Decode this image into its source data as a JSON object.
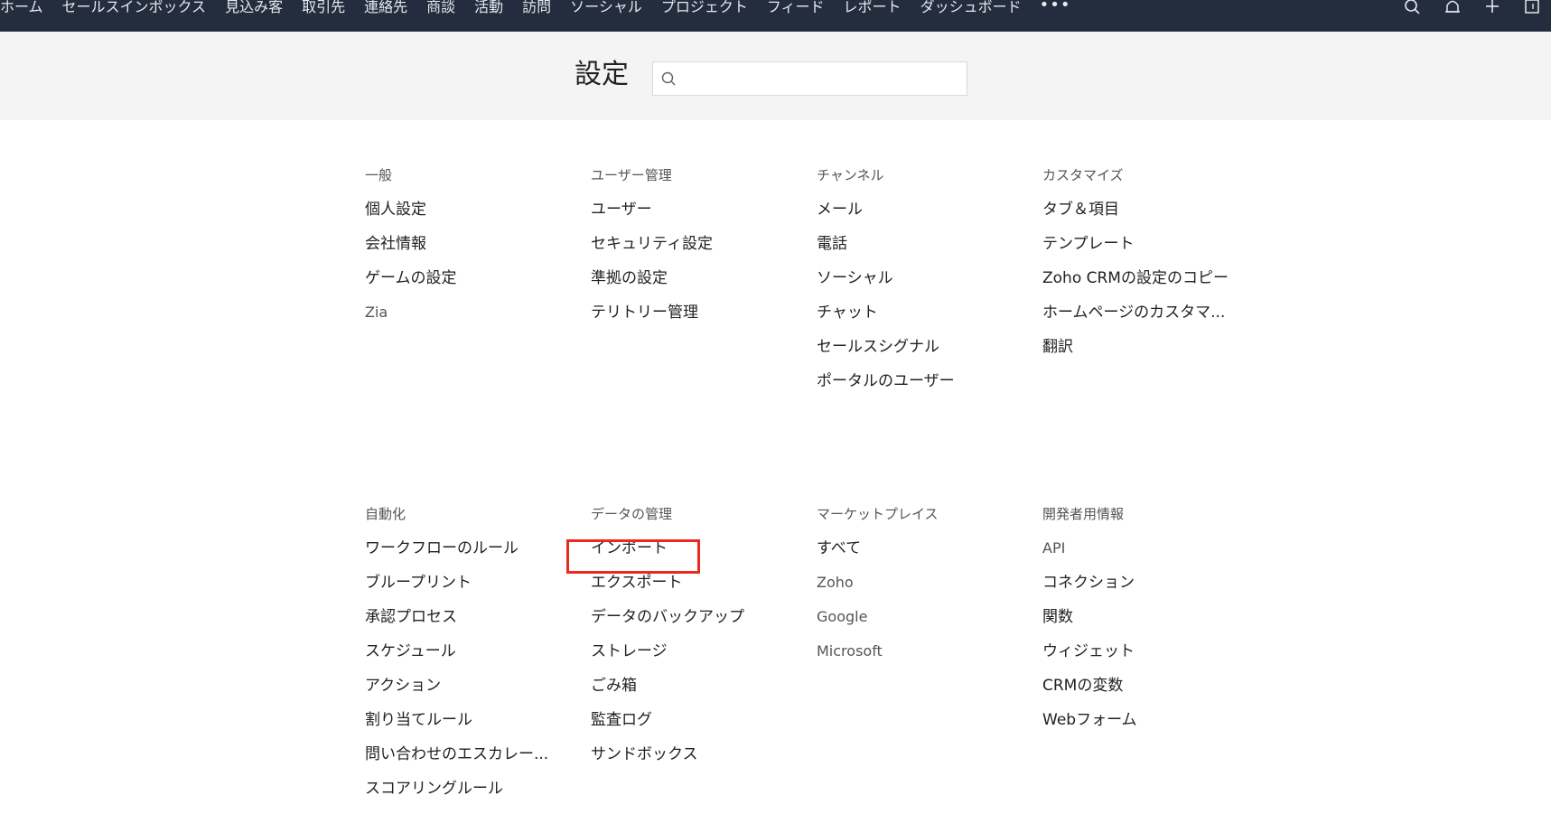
{
  "topnav": {
    "items": [
      "ホーム",
      "セールスインボックス",
      "見込み客",
      "取引先",
      "連絡先",
      "商談",
      "活動",
      "訪問",
      "ソーシャル",
      "プロジェクト",
      "フィード",
      "レポート",
      "ダッシュボード"
    ],
    "more": "•••"
  },
  "header": {
    "title": "設定",
    "search_placeholder": ""
  },
  "sections_row1": [
    {
      "title": "一般",
      "items": [
        "個人設定",
        "会社情報",
        "ゲームの設定",
        "Zia"
      ]
    },
    {
      "title": "ユーザー管理",
      "items": [
        "ユーザー",
        "セキュリティ設定",
        "準拠の設定",
        "テリトリー管理"
      ]
    },
    {
      "title": "チャンネル",
      "items": [
        "メール",
        "電話",
        "ソーシャル",
        "チャット",
        "セールスシグナル",
        "ポータルのユーザー"
      ]
    },
    {
      "title": "カスタマイズ",
      "items": [
        "タブ＆項目",
        "テンプレート",
        "Zoho CRMの設定のコピー",
        "ホームページのカスタマ...",
        "翻訳"
      ]
    }
  ],
  "sections_row2": [
    {
      "title": "自動化",
      "items": [
        "ワークフローのルール",
        "ブループリント",
        "承認プロセス",
        "スケジュール",
        "アクション",
        "割り当てルール",
        "問い合わせのエスカレー...",
        "スコアリングルール"
      ]
    },
    {
      "title": "データの管理",
      "items": [
        "インポート",
        "エクスポート",
        "データのバックアップ",
        "ストレージ",
        "ごみ箱",
        "監査ログ",
        "サンドボックス"
      ]
    },
    {
      "title": "マーケットプレイス",
      "items": [
        "すべて",
        "Zoho",
        "Google",
        "Microsoft"
      ]
    },
    {
      "title": "開発者用情報",
      "items": [
        "API",
        "コネクション",
        "関数",
        "ウィジェット",
        "CRMの変数",
        "Webフォーム"
      ]
    }
  ],
  "colors": {
    "nav_bg": "#232d3d",
    "header_bg": "#f4f4f5",
    "highlight": "#e82a1f"
  }
}
